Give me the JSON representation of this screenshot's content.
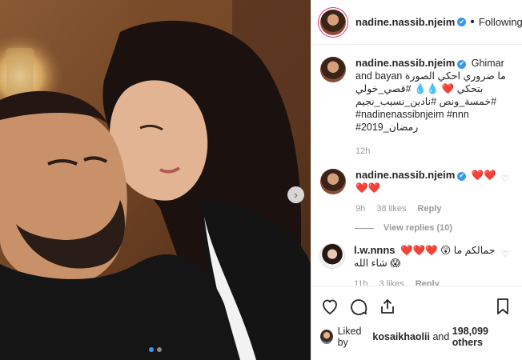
{
  "post": {
    "username": "nadine.nassib.njeim",
    "separator": "•",
    "follow_state": "Following"
  },
  "caption": {
    "username": "nadine.nassib.njeim",
    "text": "Ghimar and bayan ما ضروري احكي الصورة بتحكي ❤️ 💧💧 #قصي_خولي #خمسة_ونص #نادين_نسيب_نجيم #nadinenassibnjeim #nnn #2019_رمضان",
    "time": "12h"
  },
  "comments": [
    {
      "username": "nadine.nassib.njeim",
      "text": "❤️❤️❤️❤️",
      "time": "9h",
      "likes": "38 likes",
      "reply": "Reply",
      "view_replies": "View replies (10)"
    },
    {
      "username": "l.w.nnns",
      "text": "❤️❤️❤️ 😲 جمالكم ما شاء الله 😱",
      "time": "11h",
      "likes": "3 likes",
      "reply": "Reply"
    }
  ],
  "likes": {
    "prefix": "Liked by",
    "user": "kosaikhaolii",
    "conjunction": "and",
    "others": "198,099 others"
  },
  "icons": {
    "verified": "✔",
    "next": "›",
    "heart_small": "♡"
  },
  "colors": {
    "accent": "#3897f0",
    "hashtag": "#003569",
    "muted": "#999999"
  }
}
